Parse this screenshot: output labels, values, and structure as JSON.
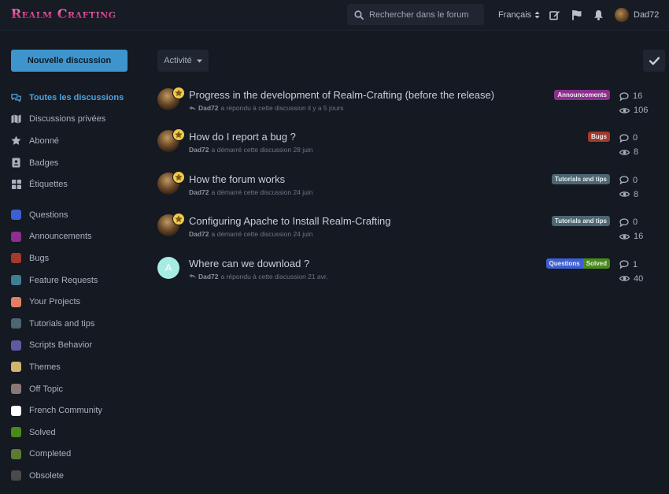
{
  "header": {
    "logo": "Realm Crafting",
    "search_placeholder": "Rechercher dans le forum",
    "language": "Français",
    "username": "Dad72"
  },
  "sidebar": {
    "new_discussion": "Nouvelle discussion",
    "nav": [
      {
        "label": "Toutes les discussions",
        "icon": "comments-icon",
        "active": true
      },
      {
        "label": "Discussions privées",
        "icon": "map-icon",
        "active": false
      },
      {
        "label": "Abonné",
        "icon": "star-icon",
        "active": false
      },
      {
        "label": "Badges",
        "icon": "badge-icon",
        "active": false
      },
      {
        "label": "Étiquettes",
        "icon": "grid-icon",
        "active": false
      }
    ],
    "tags": [
      {
        "label": "Questions",
        "color": "#3d5fd4"
      },
      {
        "label": "Announcements",
        "color": "#8e2e8e"
      },
      {
        "label": "Bugs",
        "color": "#a33a2a"
      },
      {
        "label": "Feature Requests",
        "color": "#3f7d92"
      },
      {
        "label": "Your Projects",
        "color": "#e07f63"
      },
      {
        "label": "Tutorials and tips",
        "color": "#4c6672"
      },
      {
        "label": "Scripts Behavior",
        "color": "#5e5aa0"
      },
      {
        "label": "Themes",
        "color": "#d4b36e"
      },
      {
        "label": "Off Topic",
        "color": "#8a7877"
      },
      {
        "label": "French Community",
        "color": "#ffffff"
      },
      {
        "label": "Solved",
        "color": "#4a8a1a"
      },
      {
        "label": "Completed",
        "color": "#5c7a34"
      },
      {
        "label": "Obsolete",
        "color": "#4a4a4a"
      }
    ]
  },
  "toolbar": {
    "sort_label": "Activité"
  },
  "discussions": [
    {
      "title": "Progress in the development of Realm-Crafting (before the release)",
      "author": "Dad72",
      "action": "a répondu à cette discussion il y a 5 jours",
      "replied": true,
      "tags": [
        {
          "label": "Announcements",
          "color": "#8e2e8e"
        }
      ],
      "replies": "16",
      "views": "106",
      "avatar_letter": ""
    },
    {
      "title": "How do I report a bug ?",
      "author": "Dad72",
      "action": "a démarré cette discussion 28 juin",
      "replied": false,
      "tags": [
        {
          "label": "Bugs",
          "color": "#a33a2a"
        }
      ],
      "replies": "0",
      "views": "8",
      "avatar_letter": ""
    },
    {
      "title": "How the forum works",
      "author": "Dad72",
      "action": "a démarré cette discussion 24 juin",
      "replied": false,
      "tags": [
        {
          "label": "Tutorials and tips",
          "color": "#4c6672"
        }
      ],
      "replies": "0",
      "views": "8",
      "avatar_letter": ""
    },
    {
      "title": "Configuring Apache to Install Realm-Crafting",
      "author": "Dad72",
      "action": "a démarré cette discussion 24 juin",
      "replied": false,
      "tags": [
        {
          "label": "Tutorials and tips",
          "color": "#4c6672"
        }
      ],
      "replies": "0",
      "views": "16",
      "avatar_letter": ""
    },
    {
      "title": "Where can we download ?",
      "author": "Dad72",
      "action": "a répondu à cette discussion 21 avr.",
      "replied": true,
      "tags": [
        {
          "label": "Questions",
          "color": "#3d5fd4"
        },
        {
          "label": "Solved",
          "color": "#4a8a1a"
        }
      ],
      "replies": "1",
      "views": "40",
      "avatar_letter": "A"
    }
  ]
}
